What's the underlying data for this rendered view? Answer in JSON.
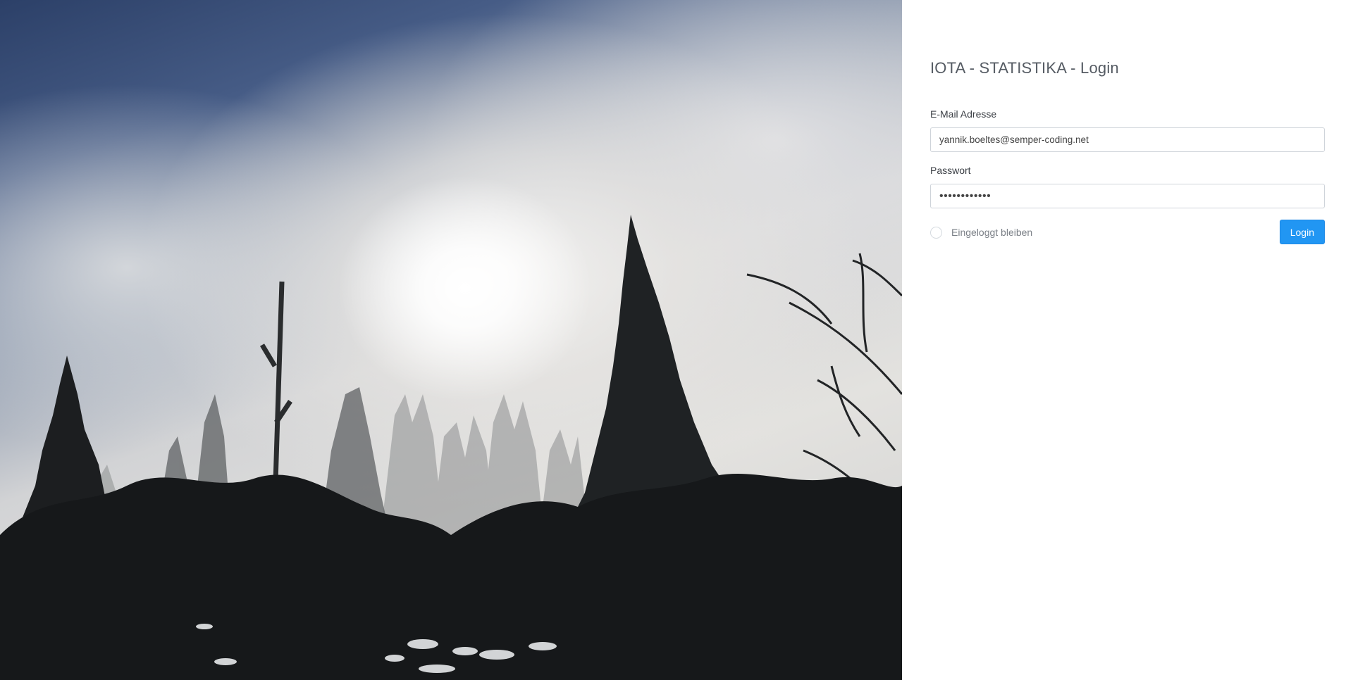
{
  "login": {
    "title": "IOTA - STATISTIKA - Login",
    "email_label": "E-Mail Adresse",
    "email_value": "yannik.boeltes@semper-coding.net",
    "password_label": "Passwort",
    "password_value": "••••••••••••",
    "remember_label": "Eingeloggt bleiben",
    "remember_checked": false,
    "submit_label": "Login"
  },
  "colors": {
    "accent": "#2196f3",
    "panel_background": "#ffffff",
    "input_border": "#cfd4da"
  }
}
